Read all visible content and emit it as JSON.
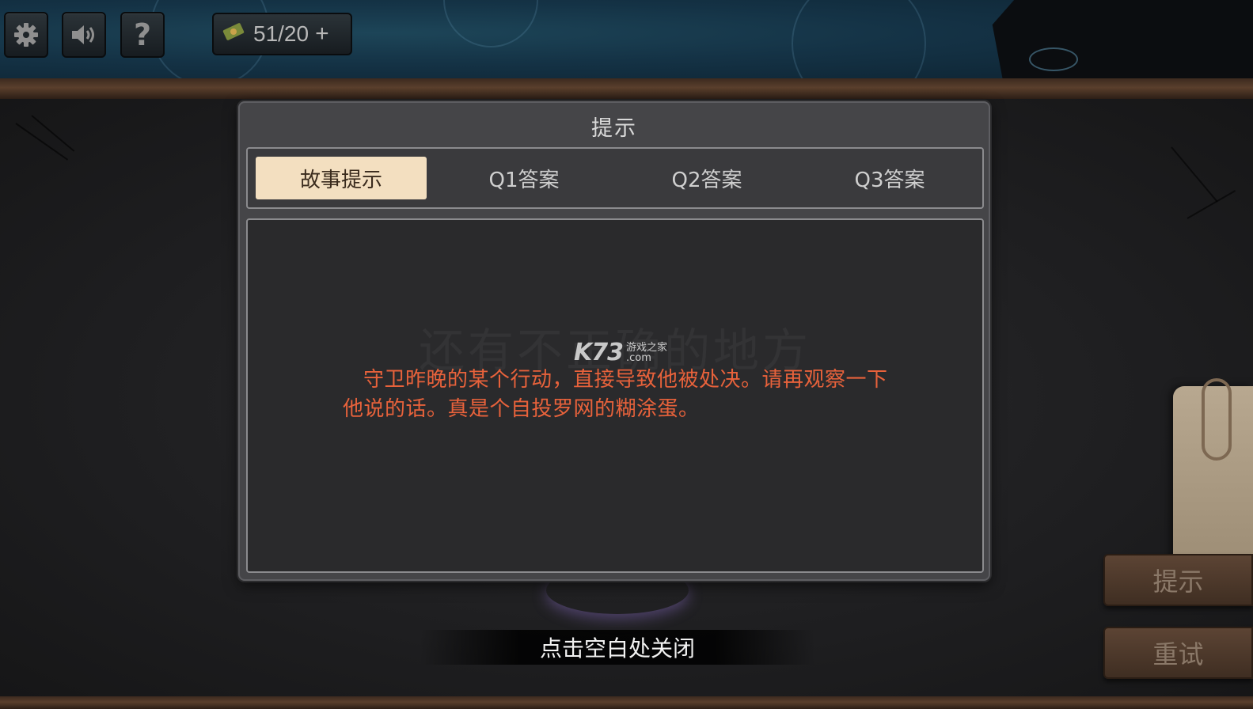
{
  "hud": {
    "settings_icon": "gear-icon",
    "sound_icon": "speaker-icon",
    "help_icon": "question-mark-icon",
    "currency_icon": "ticket-icon",
    "currency_value": "51/20",
    "currency_add": "+"
  },
  "dialog": {
    "title": "提示",
    "tabs": [
      {
        "label": "故事提示",
        "active": true
      },
      {
        "label": "Q1答案",
        "active": false
      },
      {
        "label": "Q2答案",
        "active": false
      },
      {
        "label": "Q3答案",
        "active": false
      }
    ],
    "background_text": "还有不正确的地方",
    "hint_text": "守卫昨晚的某个行动，直接导致他被处决。请再观察一下他说的话。真是个自投罗网的糊涂蛋。",
    "watermark": {
      "brand": "K73",
      "line1": "游戏之家",
      "line2": ".com"
    }
  },
  "close_prompt": "点击空白处关闭",
  "side_buttons": {
    "hint": "提示",
    "retry": "重试"
  },
  "colors": {
    "hint_text": "#e8623b",
    "active_tab": "#f3dfc0",
    "dialog_bg": "#454548"
  }
}
